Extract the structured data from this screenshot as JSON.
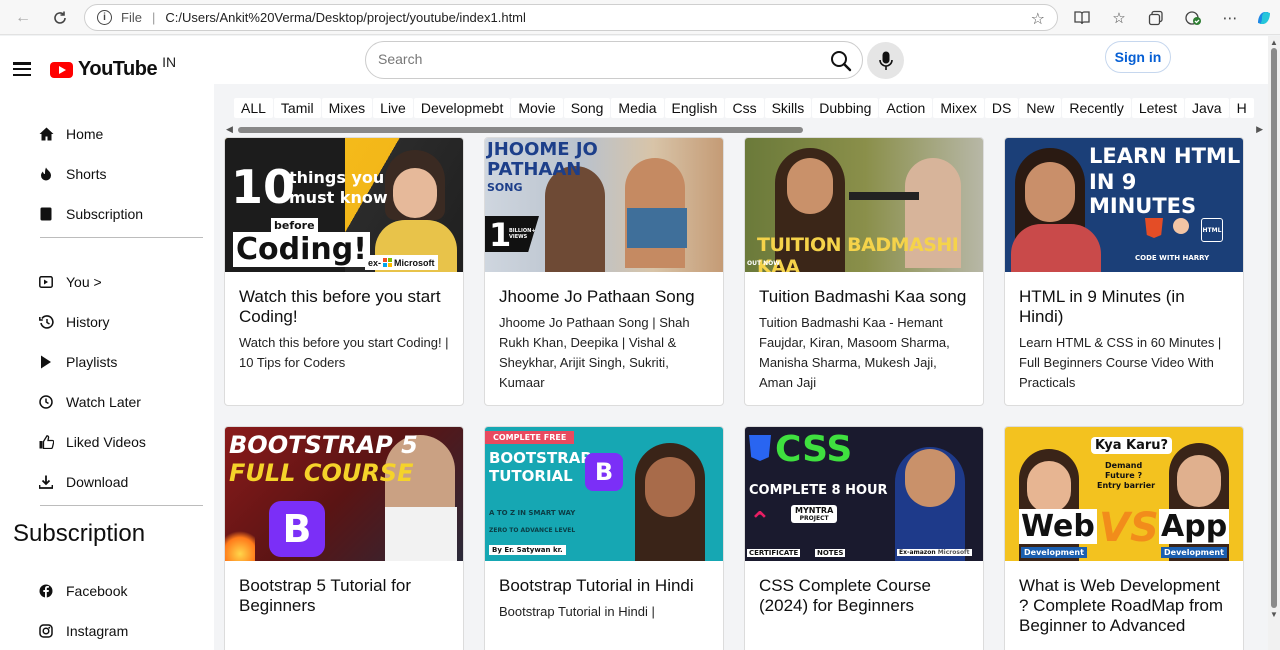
{
  "browser": {
    "file_label": "File",
    "url": "C:/Users/Ankit%20Verma/Desktop/project/youtube/index1.html"
  },
  "header": {
    "brand": "YouTube",
    "region": "IN",
    "search_placeholder": "Search",
    "signin_label": "Sign in"
  },
  "sidebar": {
    "primary": [
      {
        "label": "Home",
        "icon": "home-icon"
      },
      {
        "label": "Shorts",
        "icon": "shorts-icon"
      },
      {
        "label": "Subscription",
        "icon": "subscription-icon"
      }
    ],
    "secondary": [
      {
        "label": "You >",
        "icon": "you-icon"
      },
      {
        "label": "History",
        "icon": "history-icon"
      },
      {
        "label": "Playlists",
        "icon": "playlists-icon"
      },
      {
        "label": "Watch Later",
        "icon": "clock-icon"
      },
      {
        "label": "Liked Videos",
        "icon": "thumbs-up-icon"
      },
      {
        "label": "Download",
        "icon": "download-icon"
      }
    ],
    "subscription_title": "Subscription",
    "subscriptions": [
      {
        "label": "Facebook",
        "icon": "facebook-icon"
      },
      {
        "label": "Instagram",
        "icon": "instagram-icon"
      }
    ]
  },
  "chips": [
    "ALL",
    "Tamil",
    "Mixes",
    "Live",
    "Developmebt",
    "Movie",
    "Song",
    "Media",
    "English",
    "Css",
    "Skills",
    "Dubbing",
    "Action",
    "Mixex",
    "DS",
    "New",
    "Recently",
    "Letest",
    "Java",
    "H"
  ],
  "videos": [
    {
      "title": "Watch this before you start Coding!",
      "desc": "Watch this before you start Coding! | 10 Tips for Coders",
      "thumb": {
        "big": "10",
        "line1": "things you",
        "line2": "must know",
        "line3": "before",
        "line4": "Coding!",
        "badge": "ex-",
        "brand": "Microsoft"
      }
    },
    {
      "title": "Jhoome Jo Pathaan Song",
      "desc": "Jhoome Jo Pathaan Song | Shah Rukh Khan, Deepika | Vishal & Sheykhar, Arijit Singh, Sukriti, Kumaar",
      "thumb": {
        "line1": "JHOOME JO",
        "line2": "PATHAAN",
        "line3": "SONG",
        "big": "1",
        "small": "BILLION+ VIEWS"
      }
    },
    {
      "title": "Tuition Badmashi Kaa song",
      "desc": "Tuition Badmashi Kaa - Hemant Faujdar, Kiran, Masoom Sharma, Manisha Sharma, Mukesh Jaji, Aman Jaji",
      "thumb": {
        "line1": "TUITION BADMASHI KAA",
        "small": "OUT NOW"
      }
    },
    {
      "title": "HTML in 9 Minutes (in Hindi)",
      "desc": "Learn HTML & CSS in 60 Minutes | Full Beginners Course Video With Practicals",
      "thumb": {
        "line1": "LEARN HTML",
        "line2": "IN 9 MINUTES",
        "small": "CODE WITH HARRY",
        "html": "HTML"
      }
    },
    {
      "title": "Bootstrap 5 Tutorial for Beginners",
      "desc": "",
      "thumb": {
        "line1": "BOOTSTRAP 5",
        "line2": "FULL COURSE",
        "big": "B"
      }
    },
    {
      "title": "Bootstrap Tutorial in Hindi",
      "desc": "Bootstrap Tutorial in Hindi |",
      "thumb": {
        "badge": "COMPLETE FREE",
        "line1": "BOOTSTRAP",
        "line2": "TUTORIAL",
        "line3": "A TO Z IN SMART WAY",
        "line4": "ZERO TO ADVANCE LEVEL",
        "small": "By Er. Satywan kr.",
        "big": "B"
      }
    },
    {
      "title": "CSS Complete Course (2024) for Beginners",
      "desc": "",
      "thumb": {
        "line1": "CSS",
        "line2": "COMPLETE 8 HOUR",
        "line3": "MYNTRA",
        "line4": "PROJECT",
        "badge": "CERTIFICATE",
        "small": "NOTES",
        "brand": "Ex-amazon",
        "brand2": "Microsoft"
      }
    },
    {
      "title": "What is Web Development ? Complete RoadMap from Beginner to Advanced",
      "desc": "",
      "thumb": {
        "line1": "Kya Karu?",
        "line2": "Demand",
        "line3": "Future ?",
        "line4": "Entry barrier",
        "big": "Web",
        "vs": "VS",
        "app": "App",
        "small": "Development"
      }
    }
  ],
  "colors": {
    "accent": "#065fd4",
    "youtube_red": "#ff0000"
  }
}
